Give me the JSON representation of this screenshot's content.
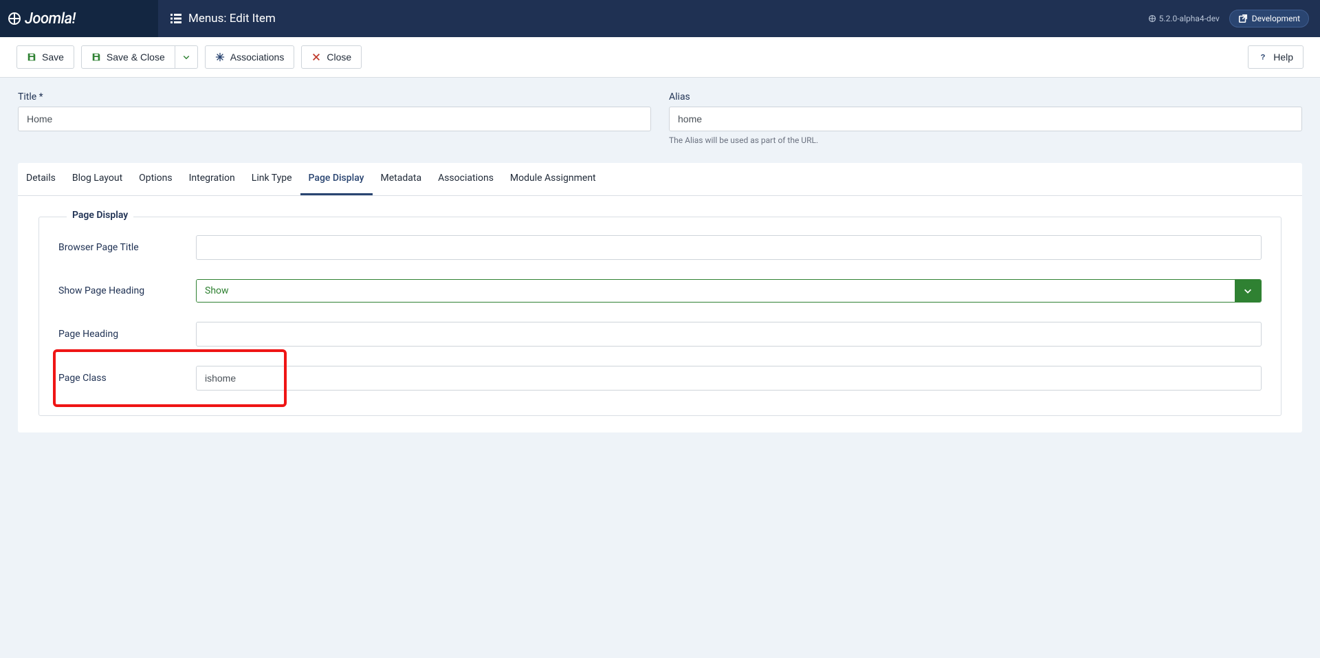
{
  "brand": "Joomla!",
  "page_header": "Menus: Edit Item",
  "version": "5.2.0-alpha4-dev",
  "dev_badge": "Development",
  "toolbar": {
    "save": "Save",
    "save_close": "Save & Close",
    "associations": "Associations",
    "close": "Close",
    "help": "Help"
  },
  "fields": {
    "title_label": "Title *",
    "title_value": "Home",
    "alias_label": "Alias",
    "alias_value": "home",
    "alias_hint": "The Alias will be used as part of the URL."
  },
  "tabs": [
    "Details",
    "Blog Layout",
    "Options",
    "Integration",
    "Link Type",
    "Page Display",
    "Metadata",
    "Associations",
    "Module Assignment"
  ],
  "active_tab": "Page Display",
  "fieldset_legend": "Page Display",
  "page_display": {
    "browser_title_label": "Browser Page Title",
    "browser_title_value": "",
    "show_heading_label": "Show Page Heading",
    "show_heading_value": "Show",
    "page_heading_label": "Page Heading",
    "page_heading_value": "",
    "page_class_label": "Page Class",
    "page_class_value": "ishome"
  }
}
